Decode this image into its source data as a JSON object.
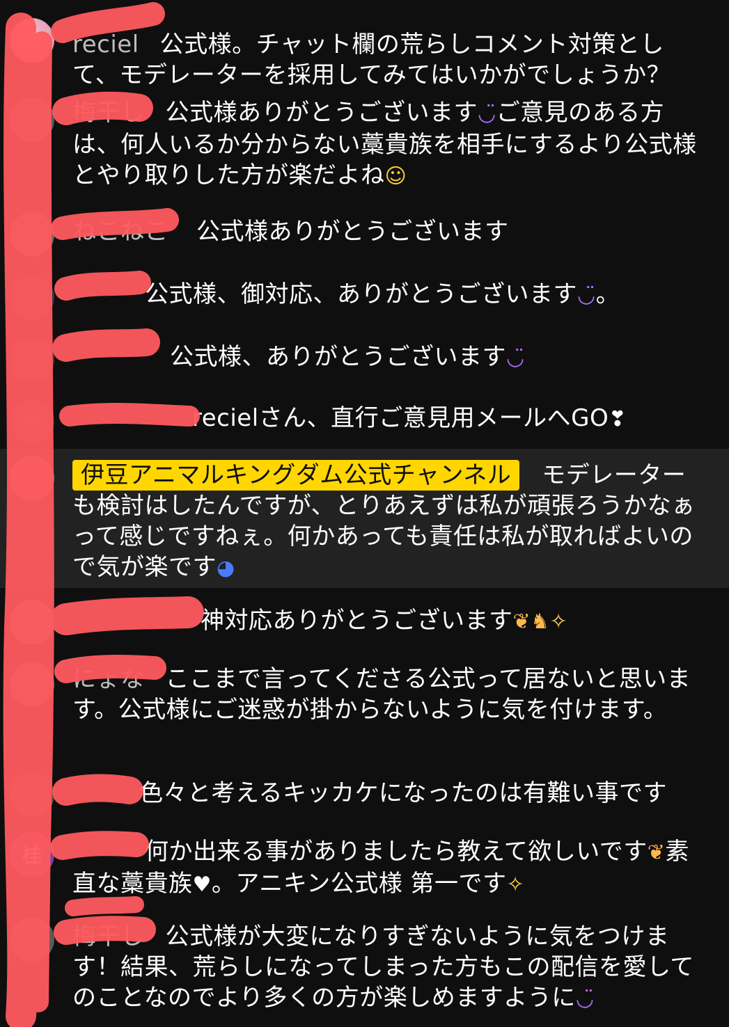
{
  "chat": {
    "messages": [
      {
        "author": "reciel",
        "text": "公式様。チャット欄の荒らしコメント対策として、モデレーターを採用してみてはいかがでしょうか？",
        "emojis": []
      },
      {
        "author": "梅干し",
        "text": "公式様ありがとうございます",
        "text2": "ご意見のある方は、何人いるか分からない藁貴族を相手にするより公式様とやり取りした方が楽だよね",
        "emojis": [
          "smiling-face",
          "rolling-laughing-face"
        ]
      },
      {
        "author": "ねこねこ",
        "text": "公式様ありがとうございます",
        "emojis": []
      },
      {
        "author": "",
        "text": "公式様、御対応、ありがとうございます",
        "text2": "。",
        "emojis": [
          "smiling-face"
        ]
      },
      {
        "author": "",
        "text": "公式様、ありがとうございます",
        "emojis": [
          "smiling-face"
        ]
      },
      {
        "author": "",
        "text": "recielさん、直行ご意見用メールへGO",
        "emojis": [
          "heart-exclamation"
        ]
      },
      {
        "author": "伊豆アニマルキングダム公式チャンネル",
        "is_owner": true,
        "text": "モデレーターも検討はしたんですが、とりあえずは私が頑張ろうかなぁって感じですねぇ。何かあっても責任は私が取ればよいので気が楽です",
        "emojis": [
          "sweat-face"
        ]
      },
      {
        "author": "",
        "text": "神対応ありがとうございます",
        "emojis": [
          "leaf",
          "giraffe",
          "sparkles"
        ]
      },
      {
        "author": "にょな",
        "text": "ここまで言ってくださる公式って居ないと思います。公式様にご迷惑が掛からないように気を付けます。",
        "emojis": []
      },
      {
        "author": "",
        "text": "色々と考えるキッカケになったのは有難い事です",
        "emojis": []
      },
      {
        "author": "桂",
        "text": "何か出来る事がありましたら教えて欲しいです",
        "text2": "素直な藁貴族",
        "text3": "。アニキン公式様 第一です",
        "emojis": [
          "leaf",
          "white-heart",
          "sparkles"
        ]
      },
      {
        "author": "梅干し",
        "text": "公式様が大変になりすぎないように気をつけます！結果、荒らしになってしまった方もこの配信を愛してのことなのでより多くの方が楽しめますように",
        "emojis": [
          "smiling-face"
        ]
      }
    ]
  },
  "colors": {
    "background": "#0f0f0f",
    "owner_row": "#222222",
    "owner_badge": "#ffd600",
    "author_text": "#bdbdbd",
    "redaction": "#ff5a5f"
  }
}
